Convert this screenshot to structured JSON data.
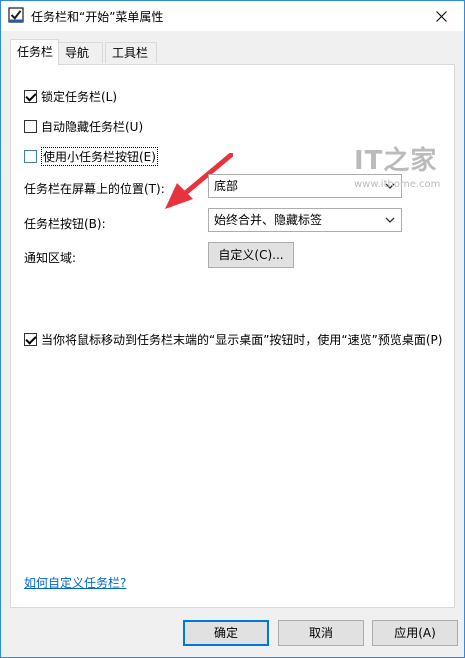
{
  "window": {
    "title": "任务栏和“开始”菜单属性"
  },
  "tabs": [
    {
      "label": "任务栏",
      "active": true
    },
    {
      "label": "导航",
      "active": false
    },
    {
      "label": "工具栏",
      "active": false
    }
  ],
  "options": {
    "lock_taskbar": {
      "label": "锁定任务栏(L)",
      "checked": true
    },
    "auto_hide": {
      "label": "自动隐藏任务栏(U)",
      "checked": false
    },
    "small_buttons": {
      "label": "使用小任务栏按钮(E)",
      "checked": false
    }
  },
  "settings": {
    "position": {
      "label": "任务栏在屏幕上的位置(T):",
      "value": "底部"
    },
    "buttons": {
      "label": "任务栏按钮(B):",
      "value": "始终合并、隐藏标签"
    },
    "notification": {
      "label": "通知区域:",
      "button_label": "自定义(C)..."
    }
  },
  "peek": {
    "label": "当你将鼠标移动到任务栏末端的“显示桌面”按钮时，使用“速览”预览桌面(P)",
    "checked": true
  },
  "help_link": "如何自定义任务栏?",
  "footer": {
    "ok": "确定",
    "cancel": "取消",
    "apply": "应用(A)"
  },
  "watermark": {
    "logo": "IT之家",
    "url": "www.ithome.com"
  },
  "colors": {
    "accent": "#0078d7",
    "link": "#0066cc",
    "annotation_arrow": "#e8323c"
  },
  "icons": {
    "title": "checkbox-window-icon",
    "close": "close-icon",
    "dropdown": "chevron-down-icon",
    "annotation": "red-arrow-icon"
  }
}
